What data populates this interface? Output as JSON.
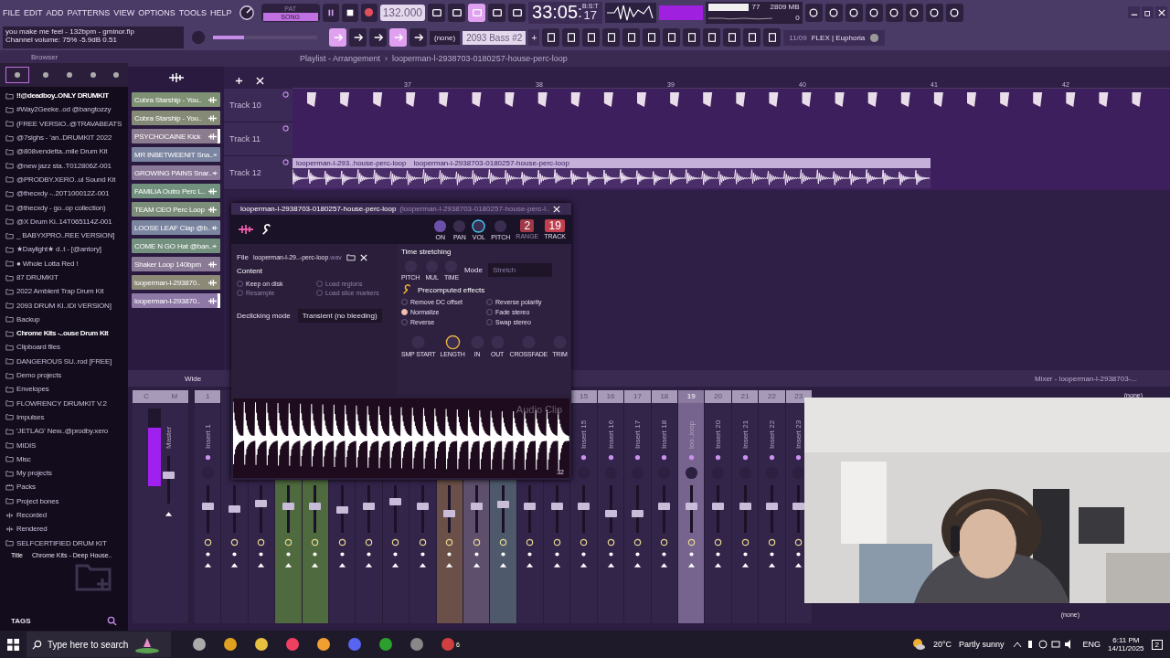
{
  "menu": [
    "FILE",
    "EDIT",
    "ADD",
    "PATTERNS",
    "VIEW",
    "OPTIONS",
    "TOOLS",
    "HELP"
  ],
  "transport": {
    "modes": [
      {
        "label": "PAT",
        "selected": false
      },
      {
        "label": "SONG",
        "selected": true
      }
    ],
    "tempo": "132.000",
    "time": "33:05",
    "time_separator": ":",
    "ticks": "17",
    "time_format": "B:S:T"
  },
  "monitor": {
    "cpu": "77",
    "memory": "2809 MB",
    "polyphony": "0"
  },
  "hint": [
    "you make me feel - 132bpm - gminor.flp",
    "Channel volume: 75%  -5.9dB  0.51"
  ],
  "master_volume": {
    "level": 0.3
  },
  "snap": "(none)",
  "pattern": "2093 Bass #2",
  "pattern_add": "+",
  "news": {
    "date": "11/09",
    "title": "FLEX | Euphoria"
  },
  "browser": {
    "title": "Browser",
    "items": [
      {
        "label": "!!@deadboy..ONLY DRUMKIT",
        "kind": "folder",
        "selected": true
      },
      {
        "label": "#Way2Geeke..od @bangtozzy",
        "kind": "folder",
        "selected": false
      },
      {
        "label": "(FREE VERSIO..@TRAVABEATS",
        "kind": "folder",
        "selected": false
      },
      {
        "label": "@7sighs - 'an..DRUMKIT 2022",
        "kind": "folder",
        "selected": false
      },
      {
        "label": "@808vendetta..mile Drum Kit",
        "kind": "folder",
        "selected": false
      },
      {
        "label": "@new jazz sta..T012806Z-001",
        "kind": "folder",
        "selected": false
      },
      {
        "label": "@PRODBY.XERO..ul Sound Kit",
        "kind": "folder",
        "selected": false
      },
      {
        "label": "@thecxdy -..20T100012Z-001",
        "kind": "folder",
        "selected": false
      },
      {
        "label": "@thecxdy - go..op collection)",
        "kind": "folder",
        "selected": false
      },
      {
        "label": "@X Drum Ki..14T065114Z-001",
        "kind": "folder",
        "selected": false
      },
      {
        "label": "_  BABYXPRO..REE VERSION]",
        "kind": "folder",
        "selected": false
      },
      {
        "label": "★Daylight★ d..t - [@antory]",
        "kind": "folder",
        "selected": false
      },
      {
        "label": "● Whole Lotta Red !",
        "kind": "folder",
        "selected": false
      },
      {
        "label": "87 DRUMKIT",
        "kind": "folder",
        "selected": false
      },
      {
        "label": "2022 Ambient Trap Drum Kit",
        "kind": "folder",
        "selected": false
      },
      {
        "label": "2093 DRUM KI..IDI VERSION]",
        "kind": "folder",
        "selected": false
      },
      {
        "label": "Backup",
        "kind": "backup",
        "selected": false
      },
      {
        "label": "Chrome Kits -..ouse Drum Kit",
        "kind": "folder",
        "selected": true
      },
      {
        "label": "Clipboard files",
        "kind": "folder",
        "selected": false
      },
      {
        "label": "DANGEROUS SU..rod [FREE]",
        "kind": "folder",
        "selected": false
      },
      {
        "label": "Demo projects",
        "kind": "folder",
        "selected": false
      },
      {
        "label": "Envelopes",
        "kind": "folder",
        "selected": false
      },
      {
        "label": "FLOWRENCY DRUMKIT V.2",
        "kind": "folder",
        "selected": false
      },
      {
        "label": "Impulses",
        "kind": "folder",
        "selected": false
      },
      {
        "label": "'JETLAG' New..@prodby.xero",
        "kind": "folder",
        "selected": false
      },
      {
        "label": "MIDIS",
        "kind": "folder",
        "selected": false
      },
      {
        "label": "Misc",
        "kind": "folder",
        "selected": false
      },
      {
        "label": "My projects",
        "kind": "folder",
        "selected": false
      },
      {
        "label": "Packs",
        "kind": "packs",
        "selected": false
      },
      {
        "label": "Project bones",
        "kind": "folder",
        "selected": false
      },
      {
        "label": "Recorded",
        "kind": "recorded",
        "selected": false
      },
      {
        "label": "Rendered",
        "kind": "rendered",
        "selected": false
      },
      {
        "label": "SELFCERTIFIED DRUM KIT",
        "kind": "folder",
        "selected": false
      }
    ],
    "info_label": "Title",
    "info_value": "Chrome Kits - Deep House..",
    "tags": "TAGS"
  },
  "playlist": {
    "title": "Playlist - Arrangement",
    "separator": "›",
    "pattern": "looperman-l-2938703-0180257-house-perc-loop",
    "channels": [
      {
        "name": "Cobra Starship - You..",
        "color": "#7f9174",
        "selected": false
      },
      {
        "name": "Cobra Starship - You..",
        "color": "#848a76",
        "selected": false
      },
      {
        "name": "PSYCHOCAINE Kick",
        "color": "#8c7c8f",
        "selected": true
      },
      {
        "name": "MR INBETWEENIT Sna..",
        "color": "#7b84a0",
        "selected": false
      },
      {
        "name": "GROWING PAINS Snar..",
        "color": "#8a7898",
        "selected": false
      },
      {
        "name": "FAMILIA Outro Perc L..",
        "color": "#72917e",
        "selected": false
      },
      {
        "name": "TEAM CEO Perc Loop",
        "color": "#7c8e79",
        "selected": false
      },
      {
        "name": "LOOSE LEAF Clap @b..",
        "color": "#7b85a0",
        "selected": false
      },
      {
        "name": "COME N GO Hat @ban..",
        "color": "#74907e",
        "selected": false
      },
      {
        "name": "Shaker Loop 140bpm",
        "color": "#8a7a95",
        "selected": false
      },
      {
        "name": "looperman-l-293870..",
        "color": "#8c8977",
        "selected": false
      },
      {
        "name": "looperman-l-293870..",
        "color": "#8e79a6",
        "selected": true
      }
    ],
    "bars": [
      "37",
      "38",
      "39",
      "40",
      "41",
      "42"
    ],
    "tracks": [
      {
        "name": "Track 10",
        "kind": "pattern"
      },
      {
        "name": "Track 11",
        "kind": "empty"
      },
      {
        "name": "Track 12",
        "kind": "audio",
        "clips": [
          "looperman-l-293..house-perc-loop",
          "looperman-l-2938703-0180257-house-perc-loop"
        ]
      }
    ]
  },
  "sampler": {
    "title": "looperman-l-2938703-0180257-house-perc-loop",
    "subtitle": "(looperman-l-2938703-0180257-house-perc-l..",
    "knobs": [
      {
        "label": "ON",
        "kind": "led"
      },
      {
        "label": "PAN",
        "kind": "knob"
      },
      {
        "label": "VOL",
        "kind": "ring"
      },
      {
        "label": "PITCH",
        "kind": "knob"
      }
    ],
    "range": {
      "value": "2",
      "label": "RANGE"
    },
    "track": {
      "value": "19",
      "label": "TRACK"
    },
    "file_label": "File",
    "file": "looperman-l-29..-perc-loop",
    "file_ext": ".wav",
    "content_title": "Content",
    "content": [
      {
        "label": "Keep on disk",
        "checked": false,
        "disabled": false
      },
      {
        "label": "Load regions",
        "checked": false,
        "disabled": true
      },
      {
        "label": "Resample",
        "checked": false,
        "disabled": true
      },
      {
        "label": "Load slice markers",
        "checked": false,
        "disabled": true
      }
    ],
    "declick_label": "Declicking mode",
    "declick": "Transient (no bleeding)",
    "stretch_title": "Time stretching",
    "stretch_knobs": [
      "PITCH",
      "MUL",
      "TIME"
    ],
    "mode_label": "Mode",
    "mode": "Stretch",
    "effects_title": "Precomputed effects",
    "effects": [
      {
        "label": "Remove DC offset",
        "checked": false
      },
      {
        "label": "Reverse polarity",
        "checked": false
      },
      {
        "label": "Normalize",
        "checked": true
      },
      {
        "label": "Fade stereo",
        "checked": false
      },
      {
        "label": "Reverse",
        "checked": false
      },
      {
        "label": "Swap stereo",
        "checked": false
      }
    ],
    "bottom_knobs": [
      {
        "label": "SMP START",
        "active": false
      },
      {
        "label": "LENGTH",
        "active": true
      },
      {
        "label": "IN",
        "active": false
      },
      {
        "label": "OUT",
        "active": false
      },
      {
        "label": "CROSSFADE",
        "active": false
      },
      {
        "label": "TRIM",
        "active": false
      }
    ],
    "wave_label": "Audio Clip",
    "zoom": "32"
  },
  "mixer": {
    "title": "Mixer - looperman-l-2938703-...",
    "wide": "Wide",
    "current": "C",
    "master": {
      "label": "M",
      "name": "Master",
      "meter": {
        "level": 0.75
      },
      "level": 0.6
    },
    "routing": [
      "(none)",
      "(none)"
    ],
    "strips": [
      {
        "kind": "insert",
        "number": "1",
        "name": "Insert 1",
        "level": 0.55,
        "selected": false
      },
      {
        "kind": "covered",
        "level": 0.5,
        "selected": false
      },
      {
        "kind": "covered",
        "level": 0.62,
        "selected": false
      },
      {
        "kind": "covered",
        "level": 0.55,
        "selected": false,
        "color": "#4f6a3f"
      },
      {
        "kind": "covered",
        "level": 0.55,
        "selected": false,
        "color": "#4f6a3f"
      },
      {
        "kind": "covered",
        "level": 0.48,
        "selected": false
      },
      {
        "kind": "covered",
        "level": 0.55,
        "selected": false
      },
      {
        "kind": "covered",
        "level": 0.66,
        "selected": false
      },
      {
        "kind": "covered",
        "level": 0.55,
        "selected": false
      },
      {
        "kind": "covered",
        "level": 0.4,
        "selected": false,
        "color": "#6a5048"
      },
      {
        "kind": "covered",
        "level": 0.55,
        "selected": false,
        "color": "#5e4f6c"
      },
      {
        "kind": "covered",
        "level": 0.6,
        "selected": false,
        "color": "#4e5a6c"
      },
      {
        "kind": "covered",
        "level": 0.55,
        "selected": false
      },
      {
        "kind": "covered",
        "level": 0.55,
        "selected": false
      },
      {
        "kind": "insert",
        "number": "15",
        "name": "Insert 15",
        "level": 0.55,
        "selected": false
      },
      {
        "kind": "insert",
        "number": "16",
        "name": "Insert 16",
        "level": 0.4,
        "selected": false
      },
      {
        "kind": "insert",
        "number": "17",
        "name": "Insert 17",
        "level": 0.4,
        "selected": false
      },
      {
        "kind": "insert",
        "number": "18",
        "name": "Insert 18",
        "level": 0.55,
        "selected": false
      },
      {
        "kind": "insert",
        "number": "19",
        "name": "loo..loop",
        "level": 0.55,
        "selected": true
      },
      {
        "kind": "insert",
        "number": "20",
        "name": "Insert 20",
        "level": 0.55,
        "selected": false
      },
      {
        "kind": "insert",
        "number": "21",
        "name": "Insert 21",
        "level": 0.55,
        "selected": false
      },
      {
        "kind": "insert",
        "number": "22",
        "name": "Insert 22",
        "level": 0.55,
        "selected": false
      },
      {
        "kind": "insert",
        "number": "23",
        "name": "Insert 23",
        "level": 0.55,
        "selected": false
      }
    ]
  },
  "taskbar": {
    "search": "Type here to search",
    "app_badge": "6",
    "temperature": "20°C",
    "weather": "Partly sunny",
    "language": "ENG",
    "time": "6:11 PM",
    "date": "14/11/2025",
    "notifications": "2"
  }
}
